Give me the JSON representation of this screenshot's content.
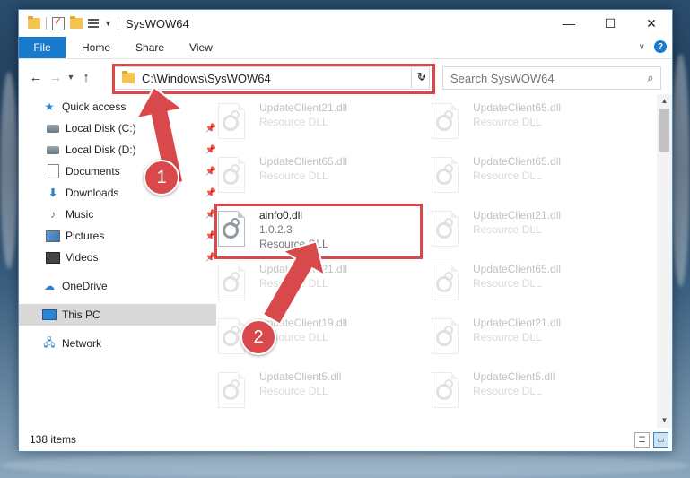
{
  "window": {
    "title": "SysWOW64",
    "controls": {
      "minimize": "—",
      "maximize": "☐",
      "close": "✕"
    }
  },
  "ribbon": {
    "tabs": [
      "File",
      "Home",
      "Share",
      "View"
    ]
  },
  "address": {
    "path": "C:\\Windows\\SysWOW64",
    "search_placeholder": "Search SysWOW64"
  },
  "nav": {
    "quick_access": "Quick access",
    "items": [
      {
        "label": "Local Disk (C:)",
        "icon": "disk-icon",
        "pinned": true
      },
      {
        "label": "Local Disk (D:)",
        "icon": "disk-icon",
        "pinned": true
      },
      {
        "label": "Documents",
        "icon": "documents-icon",
        "pinned": true
      },
      {
        "label": "Downloads",
        "icon": "downloads-icon",
        "pinned": true
      },
      {
        "label": "Music",
        "icon": "music-icon",
        "pinned": true
      },
      {
        "label": "Pictures",
        "icon": "pictures-icon",
        "pinned": true
      },
      {
        "label": "Videos",
        "icon": "videos-icon",
        "pinned": true
      }
    ],
    "onedrive": "OneDrive",
    "this_pc": "This PC",
    "network": "Network"
  },
  "files": [
    {
      "name": "UpdateClient21.dll",
      "sub1": "Resource DLL",
      "sub2": ""
    },
    {
      "name": "UpdateClient65.dll",
      "sub1": "Resource DLL",
      "sub2": ""
    },
    {
      "name": "UpdateClient65.dll",
      "sub1": "Resource DLL",
      "sub2": ""
    },
    {
      "name": "UpdateClient65.dll",
      "sub1": "Resource DLL",
      "sub2": ""
    },
    {
      "name": "ainfo0.dll",
      "sub1": "1.0.2.3",
      "sub2": "Resource DLL"
    },
    {
      "name": "UpdateClient21.dll",
      "sub1": "Resource DLL",
      "sub2": ""
    },
    {
      "name": "UpdateClient21.dll",
      "sub1": "Resource DLL",
      "sub2": ""
    },
    {
      "name": "UpdateClient65.dll",
      "sub1": "Resource DLL",
      "sub2": ""
    },
    {
      "name": "UpdateClient19.dll",
      "sub1": "Resource DLL",
      "sub2": ""
    },
    {
      "name": "UpdateClient21.dll",
      "sub1": "Resource DLL",
      "sub2": ""
    },
    {
      "name": "UpdateClient5.dll",
      "sub1": "Resource DLL",
      "sub2": ""
    },
    {
      "name": "UpdateClient5.dll",
      "sub1": "Resource DLL",
      "sub2": ""
    }
  ],
  "status": {
    "item_count": "138 items"
  },
  "callouts": [
    "1",
    "2"
  ],
  "colors": {
    "accent": "#1979ca",
    "highlight": "#d9494b"
  }
}
